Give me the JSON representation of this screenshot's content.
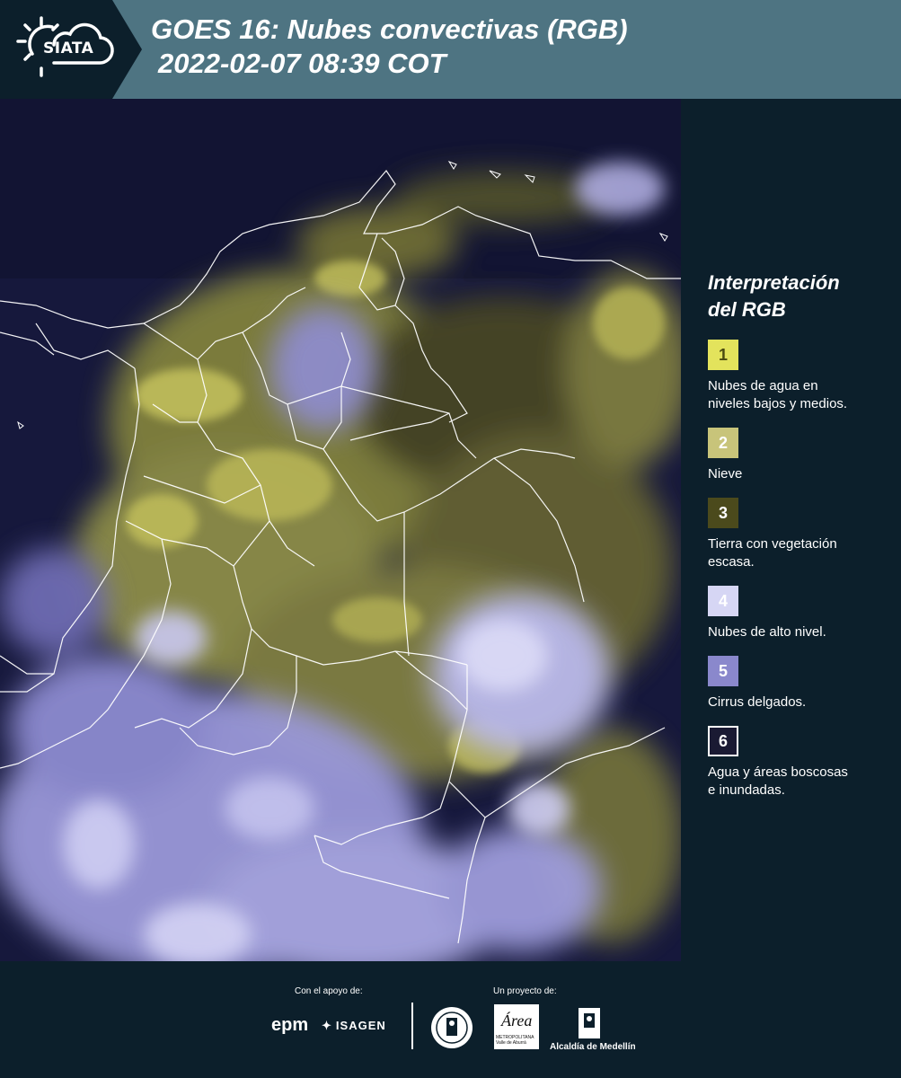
{
  "header": {
    "logo_text": "SIATA",
    "title_line1": "GOES 16: Nubes convectivas (RGB)",
    "title_line2": "2022-02-07 08:39 COT"
  },
  "legend": {
    "title_line1": "Interpretación",
    "title_line2": "del RGB",
    "items": [
      {
        "number": "1",
        "label_line1": "Nubes de agua en",
        "label_line2": "niveles bajos y medios.",
        "color": "#e3e35c",
        "text_color": "#4a4a10"
      },
      {
        "number": "2",
        "label_line1": "Nieve",
        "label_line2": "",
        "color": "#c8c47a",
        "text_color": "#ffffff"
      },
      {
        "number": "3",
        "label_line1": "Tierra con vegetación",
        "label_line2": "escasa.",
        "color": "#4b4a1c",
        "text_color": "#ffffff"
      },
      {
        "number": "4",
        "label_line1": "Nubes de alto nivel.",
        "label_line2": "",
        "color": "#d6d6f4",
        "text_color": "#ffffff"
      },
      {
        "number": "5",
        "label_line1": "Cirrus delgados.",
        "label_line2": "",
        "color": "#8a88cc",
        "text_color": "#ffffff"
      },
      {
        "number": "6",
        "label_line1": "Agua y áreas boscosas",
        "label_line2": "e inundadas.",
        "color": "#1a1a33",
        "text_color": "#ffffff"
      }
    ]
  },
  "footer": {
    "support_label": "Con el apoyo de:",
    "project_label": "Un proyecto de:",
    "sponsor_1": "epm",
    "sponsor_2": "ISAGEN",
    "area_logo_text": "Área",
    "area_logo_sub": "METROPOLITANA Valle de Aburrá",
    "alcaldia": "Alcaldía de Medellín"
  },
  "icons": [
    "sun-cloud-logo-icon",
    "isagen-mark-icon",
    "medellin-seal-icon",
    "alcaldia-building-icon"
  ]
}
